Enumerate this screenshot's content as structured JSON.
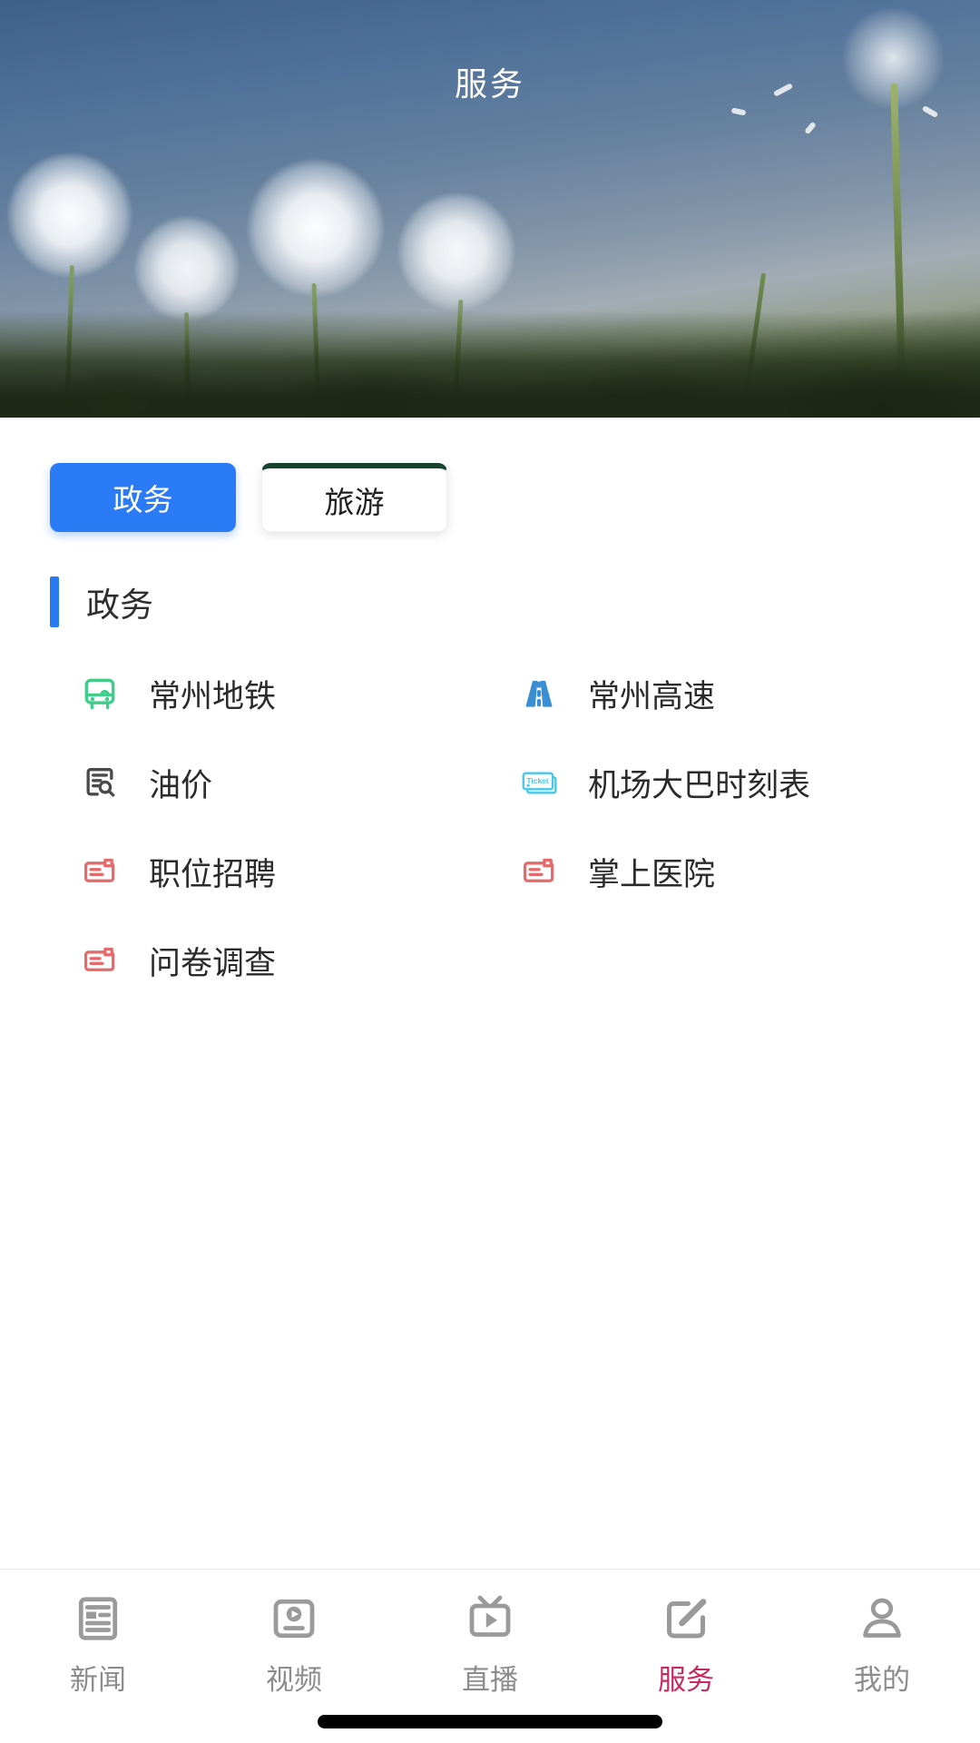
{
  "header": {
    "title": "服务"
  },
  "category_tabs": [
    {
      "label": "政务",
      "active": true
    },
    {
      "label": "旅游",
      "active": false
    }
  ],
  "section": {
    "title": "政务"
  },
  "services": [
    {
      "label": "常州地铁",
      "icon": "metro-icon",
      "color": "#42cc8c"
    },
    {
      "label": "常州高速",
      "icon": "highway-icon",
      "color": "#3a8fd4"
    },
    {
      "label": "油价",
      "icon": "oil-price-icon",
      "color": "#4a4a4a"
    },
    {
      "label": "机场大巴时刻表",
      "icon": "ticket-icon",
      "color": "#45c8e8",
      "icon_text": "Ticket"
    },
    {
      "label": "职位招聘",
      "icon": "recruitment-card-icon",
      "color": "#e36b6b"
    },
    {
      "label": "掌上医院",
      "icon": "hospital-card-icon",
      "color": "#e36b6b"
    },
    {
      "label": "问卷调查",
      "icon": "survey-card-icon",
      "color": "#e36b6b"
    }
  ],
  "tabbar": {
    "items": [
      {
        "label": "新闻",
        "icon": "news-icon",
        "active": false
      },
      {
        "label": "视频",
        "icon": "video-icon",
        "active": false
      },
      {
        "label": "直播",
        "icon": "live-tv-icon",
        "active": false
      },
      {
        "label": "服务",
        "icon": "services-compose-icon",
        "active": true
      },
      {
        "label": "我的",
        "icon": "profile-icon",
        "active": false
      }
    ],
    "active_label": "服务",
    "active_color": "#c8295f",
    "inactive_color": "#8c8c8c"
  },
  "colors": {
    "accent_blue": "#2b7bf6",
    "section_bar_blue": "#2979f2",
    "tourism_border_green": "#17432e",
    "tab_active_pink": "#c8295f"
  }
}
